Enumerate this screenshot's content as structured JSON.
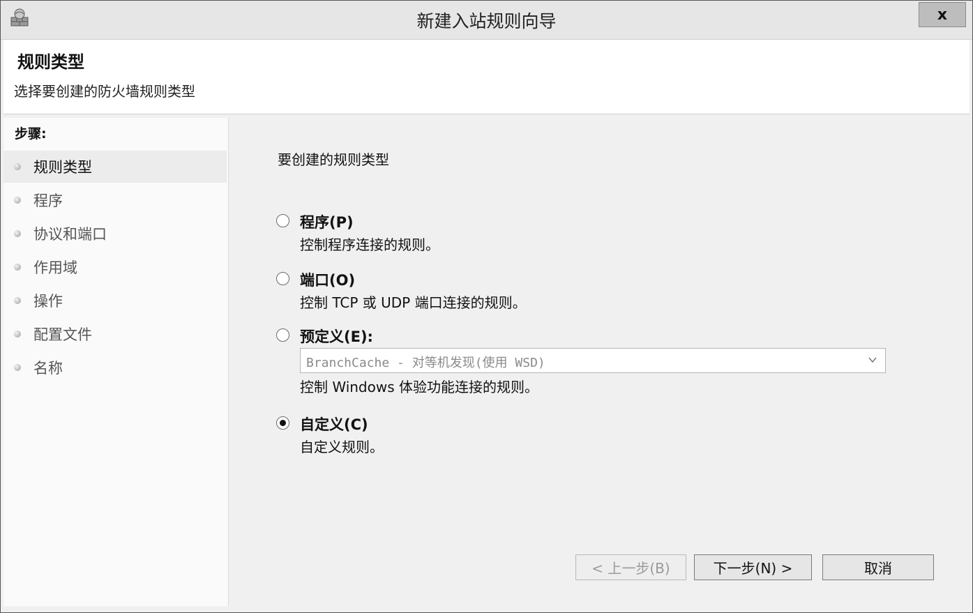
{
  "window": {
    "title": "新建入站规则向导",
    "close_label": "x"
  },
  "header": {
    "title": "规则类型",
    "subtitle": "选择要创建的防火墙规则类型"
  },
  "sidebar": {
    "title": "步骤:",
    "items": [
      {
        "label": "规则类型",
        "active": true
      },
      {
        "label": "程序",
        "active": false
      },
      {
        "label": "协议和端口",
        "active": false
      },
      {
        "label": "作用域",
        "active": false
      },
      {
        "label": "操作",
        "active": false
      },
      {
        "label": "配置文件",
        "active": false
      },
      {
        "label": "名称",
        "active": false
      }
    ]
  },
  "content": {
    "heading": "要创建的规则类型",
    "options": [
      {
        "label": "程序(P)",
        "desc": "控制程序连接的规则。",
        "checked": false
      },
      {
        "label": "端口(O)",
        "desc": "控制 TCP 或 UDP 端口连接的规则。",
        "checked": false
      },
      {
        "label": "预定义(E):",
        "desc": "控制 Windows 体验功能连接的规则。",
        "checked": false,
        "select_value": "BranchCache - 对等机发现(使用 WSD)"
      },
      {
        "label": "自定义(C)",
        "desc": "自定义规则。",
        "checked": true
      }
    ]
  },
  "buttons": {
    "back": "< 上一步(B)",
    "next": "下一步(N) >",
    "cancel": "取消"
  }
}
